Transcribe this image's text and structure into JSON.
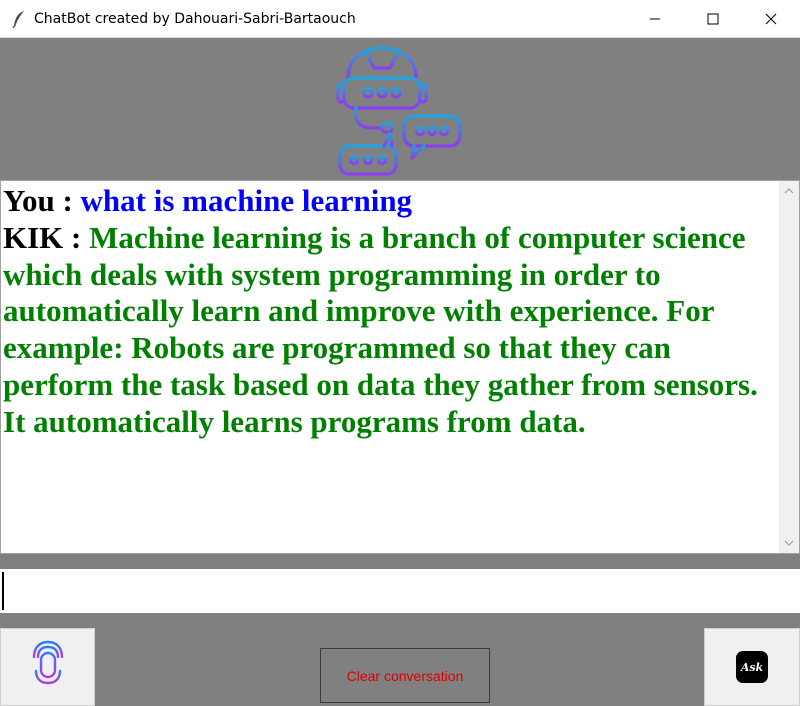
{
  "window": {
    "title": "ChatBot created by Dahouari-Sabri-Bartaouch",
    "app_icon": "feather-icon",
    "controls": [
      "minimize-icon",
      "maximize-icon",
      "close-icon"
    ]
  },
  "header": {
    "logo_icon": "robot-chatbot-icon"
  },
  "chat": {
    "user_speaker": "You : ",
    "user_message": "what is machine learning",
    "bot_speaker": "KIK : ",
    "bot_message": "Machine learning is a branch of computer science which deals with system programming in order to automatically learn and improve with experience. For example: Robots are programmed so that they can perform the task based on data they gather from sensors. It automatically learns programs from data."
  },
  "input": {
    "value": ""
  },
  "controls": {
    "mic_icon": "microphone-icon",
    "clear_label": "Clear conversation",
    "ask_label": "Ask"
  },
  "colors": {
    "background": "#808080",
    "user_text": "#0000ff",
    "bot_text": "#008000",
    "clear_text": "#e00000"
  }
}
